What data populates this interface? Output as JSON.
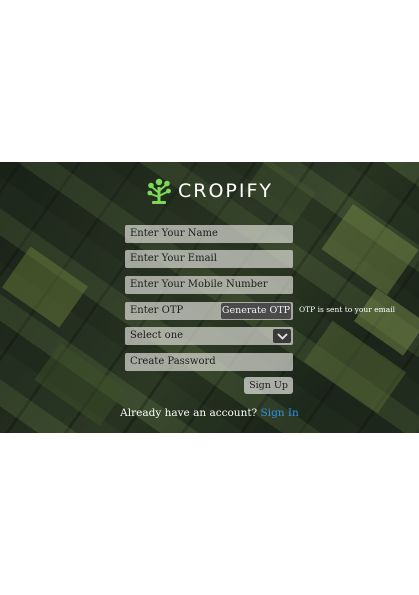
{
  "brand": {
    "name": "CROPIFY",
    "icon": "tree-icon",
    "icon_color": "#7ed957"
  },
  "form": {
    "name_placeholder": "Enter Your Name",
    "email_placeholder": "Enter Your Email",
    "mobile_placeholder": "Enter Your Mobile Number",
    "otp_placeholder": "Enter OTP",
    "generate_otp_label": "Generate OTP",
    "otp_note": "OTP is sent to your email",
    "select_value": "Select one",
    "password_placeholder": "Create Password",
    "signup_label": "Sign Up"
  },
  "footer": {
    "prompt": "Already have an account?",
    "signin_label": "Sign In",
    "link_color": "#2f8fe8"
  }
}
